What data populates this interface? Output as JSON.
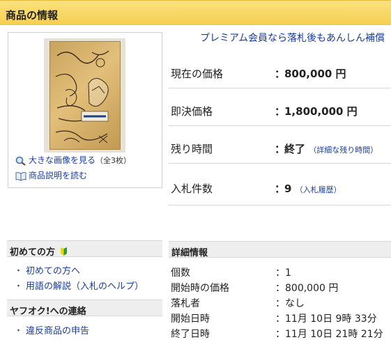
{
  "header": {
    "title": "商品の情報"
  },
  "image_panel": {
    "enlarge_link": "大きな画像を見る",
    "enlarge_note": "（全3枚）",
    "description_link": "商品説明を読む"
  },
  "premium_text": "プレミアム会員なら落札後もあんしん補償",
  "price_rows": [
    {
      "label": "現在の価格",
      "colon": "：",
      "value": "800,000 円",
      "extra": ""
    },
    {
      "label": "即決価格",
      "colon": "：",
      "value": "1,800,000 円",
      "extra": ""
    },
    {
      "label": "残り時間",
      "colon": "：",
      "value": "終了",
      "extra": "（詳細な残り時間）"
    },
    {
      "label": "入札件数",
      "colon": "：",
      "value": "9",
      "extra": "（入札履歴）"
    }
  ],
  "beginner": {
    "title": "初めての方",
    "links": [
      "初めての方へ",
      "用語の解説（入札のヘルプ）"
    ]
  },
  "contact": {
    "title": "ヤフオク!への連絡",
    "links": [
      "違反商品の申告"
    ]
  },
  "details": {
    "title": "詳細情報",
    "rows": [
      {
        "label": "個数",
        "colon": "：",
        "value": "1"
      },
      {
        "label": "開始時の価格",
        "colon": "：",
        "value": "800,000 円"
      },
      {
        "label": "落札者",
        "colon": "：",
        "value": "なし"
      },
      {
        "label": "開始日時",
        "colon": "：",
        "value": "11月 10日 9時 33分"
      },
      {
        "label": "終了日時",
        "colon": "：",
        "value": "11月 10日 21時 21分"
      }
    ]
  },
  "colors": {
    "header_bg": "#f5cf52",
    "link": "#1a3c9b",
    "section_bg": "#eeeeee"
  }
}
